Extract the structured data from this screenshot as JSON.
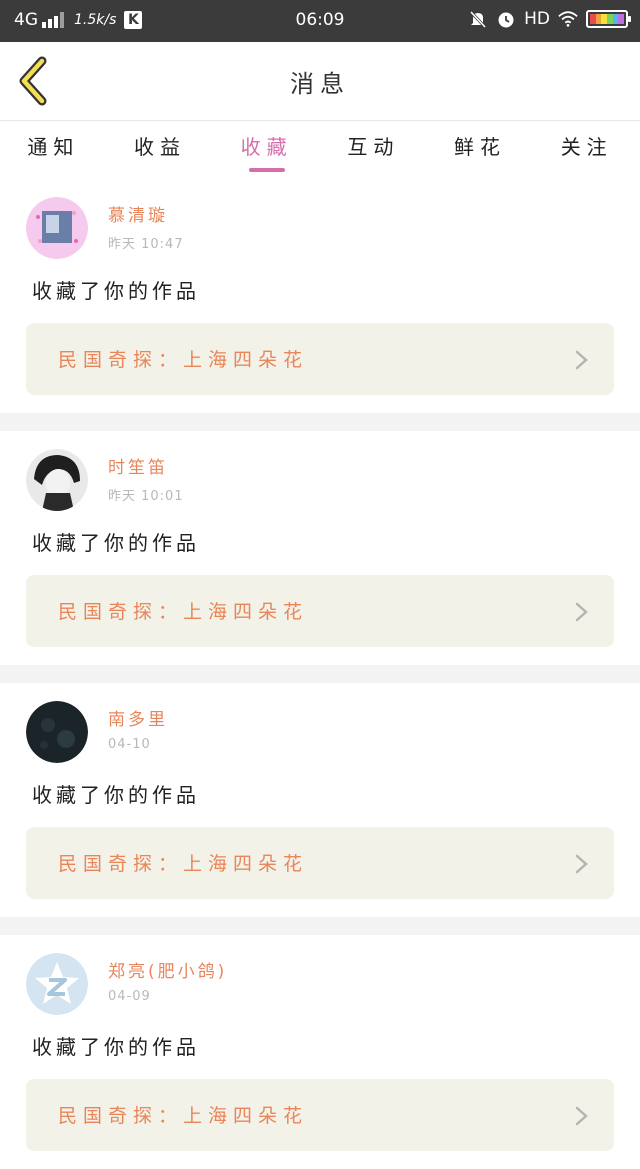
{
  "status_bar": {
    "network": "4G",
    "speed": "1.5k/s",
    "app_badge": "K",
    "time": "06:09",
    "hd": "HD"
  },
  "header": {
    "title": "消息"
  },
  "tabs": [
    {
      "label": "通知",
      "active": false
    },
    {
      "label": "收益",
      "active": false
    },
    {
      "label": "收藏",
      "active": true
    },
    {
      "label": "互动",
      "active": false
    },
    {
      "label": "鲜花",
      "active": false
    },
    {
      "label": "关注",
      "active": false
    }
  ],
  "messages": [
    {
      "name": "慕清璇",
      "time": "昨天 10:47",
      "action": "收藏了你的作品",
      "work": "民国奇探：上海四朵花"
    },
    {
      "name": "时笙笛",
      "time": "昨天 10:01",
      "action": "收藏了你的作品",
      "work": "民国奇探：上海四朵花"
    },
    {
      "name": "南多里",
      "time": "04-10",
      "action": "收藏了你的作品",
      "work": "民国奇探：上海四朵花"
    },
    {
      "name": "郑亮(肥小鸽)",
      "time": "04-09",
      "action": "收藏了你的作品",
      "work": "民国奇探：上海四朵花"
    }
  ],
  "colors": {
    "accent": "#d66eac",
    "name": "#e8865a",
    "card": "#f3f2e9",
    "status_bar": "#3b3b3b"
  }
}
